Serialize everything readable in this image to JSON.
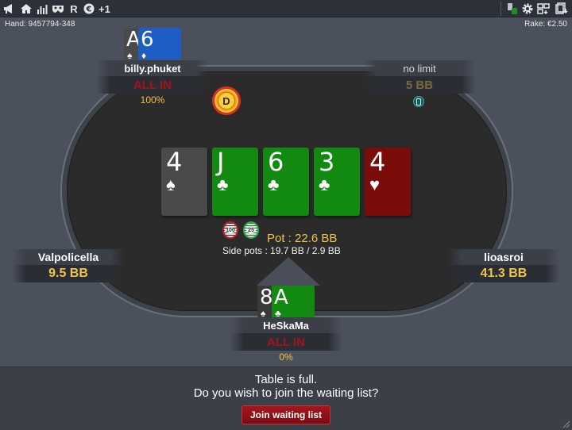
{
  "toolbar": {
    "left_icons": [
      "megaphone-icon",
      "home-icon",
      "stats-icon",
      "mask-icon",
      "R",
      "currency-icon",
      "+1"
    ],
    "r_label": "R",
    "plus_label": "+1",
    "right_icons": [
      "chat-icon",
      "gear-icon",
      "layout-icon",
      "tables-icon"
    ]
  },
  "hand": {
    "label": "Hand: 9457794-348"
  },
  "rake": {
    "label": "Rake: €2.50"
  },
  "dealer_button": {
    "label": "D"
  },
  "board": [
    {
      "rank": "4",
      "suit": "♠",
      "suit_name": "spade"
    },
    {
      "rank": "J",
      "suit": "♣",
      "suit_name": "club"
    },
    {
      "rank": "6",
      "suit": "♣",
      "suit_name": "club"
    },
    {
      "rank": "3",
      "suit": "♣",
      "suit_name": "club"
    },
    {
      "rank": "4",
      "suit": "♥",
      "suit_name": "heart"
    }
  ],
  "pot": {
    "label": "Pot : 22.6 BB",
    "side_pots": "Side pots : 19.7 BB / 2.9 BB",
    "chips": [
      "100",
      "25"
    ]
  },
  "seats": {
    "top_left": {
      "name": "billy.phuket",
      "status": "ALL IN",
      "percent": "100%",
      "cards": [
        {
          "rank": "A",
          "suit": "♠",
          "suit_name": "spade"
        },
        {
          "rank": "6",
          "suit": "♦",
          "suit_name": "diamond"
        }
      ]
    },
    "top_right": {
      "name": "no limit",
      "stack": "5 BB"
    },
    "left": {
      "name": "Valpolicella",
      "stack": "9.5 BB"
    },
    "right": {
      "name": "lioasroi",
      "stack": "41.3 BB"
    },
    "bottom": {
      "name": "HeSkaMa",
      "status": "ALL IN",
      "percent": "0%",
      "cards": [
        {
          "rank": "8",
          "suit": "♠",
          "suit_name": "spade"
        },
        {
          "rank": "A",
          "suit": "♣",
          "suit_name": "club"
        }
      ]
    }
  },
  "waiting_list": {
    "line1": "Table is full.",
    "line2": "Do you wish to join the waiting list?",
    "button": "Join waiting list"
  },
  "colors": {
    "gold": "#f0c34a",
    "allin_red": "#a3141a",
    "club_green": "#128a12",
    "heart_red": "#7a0c0c",
    "diamond_blue": "#1e5ec4",
    "spade_gray": "#4a4a4a"
  }
}
